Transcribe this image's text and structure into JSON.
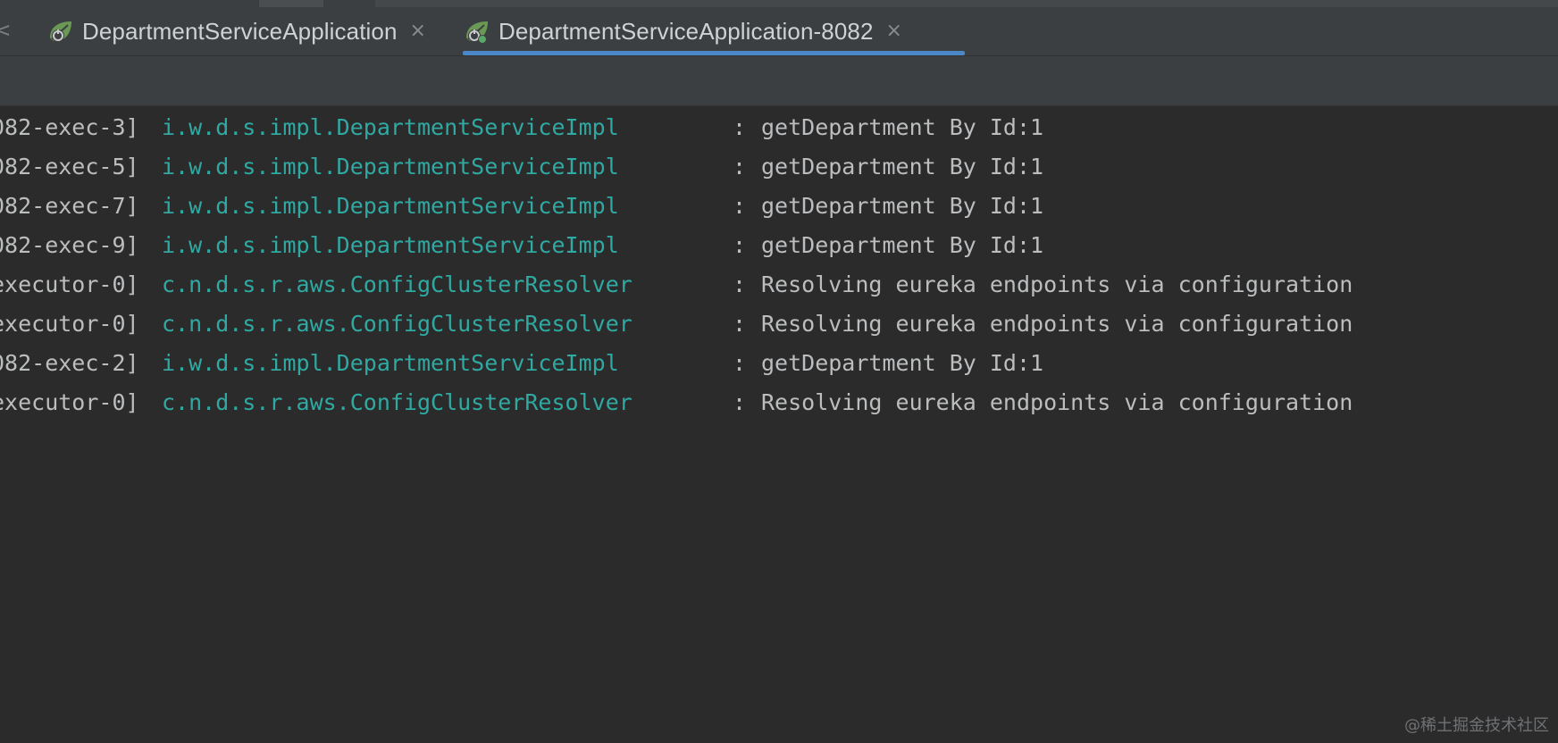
{
  "tabs": [
    {
      "label": "DepartmentServiceApplication",
      "active": false,
      "icon": "spring-boot-run-icon"
    },
    {
      "label": "DepartmentServiceApplication-8082",
      "active": true,
      "icon": "spring-boot-run-icon"
    }
  ],
  "tab_close_glyph": "×",
  "scroll_left_glyph": "<",
  "log_lines": [
    {
      "thread": "082-exec-3]",
      "logger": "i.w.d.s.impl.DepartmentServiceImpl",
      "sep": ":",
      "message": "getDepartment By Id:1"
    },
    {
      "thread": "082-exec-5]",
      "logger": "i.w.d.s.impl.DepartmentServiceImpl",
      "sep": ":",
      "message": "getDepartment By Id:1"
    },
    {
      "thread": "082-exec-7]",
      "logger": "i.w.d.s.impl.DepartmentServiceImpl",
      "sep": ":",
      "message": "getDepartment By Id:1"
    },
    {
      "thread": "082-exec-9]",
      "logger": "i.w.d.s.impl.DepartmentServiceImpl",
      "sep": ":",
      "message": "getDepartment By Id:1"
    },
    {
      "thread": "executor-0]",
      "logger": "c.n.d.s.r.aws.ConfigClusterResolver",
      "sep": ":",
      "message": "Resolving eureka endpoints via configuration"
    },
    {
      "thread": "executor-0]",
      "logger": "c.n.d.s.r.aws.ConfigClusterResolver",
      "sep": ":",
      "message": "Resolving eureka endpoints via configuration"
    },
    {
      "thread": "082-exec-2]",
      "logger": "i.w.d.s.impl.DepartmentServiceImpl",
      "sep": ":",
      "message": "getDepartment By Id:1"
    },
    {
      "thread": "executor-0]",
      "logger": "c.n.d.s.r.aws.ConfigClusterResolver",
      "sep": ":",
      "message": "Resolving eureka endpoints via configuration"
    }
  ],
  "watermark": "@稀土掘金技术社区",
  "colors": {
    "background": "#2b2b2b",
    "tab_bar": "#3c3f41",
    "active_tab_underline": "#4a88c7",
    "logger_text": "#2fa9a2",
    "plain_text": "#bbbdbf"
  }
}
